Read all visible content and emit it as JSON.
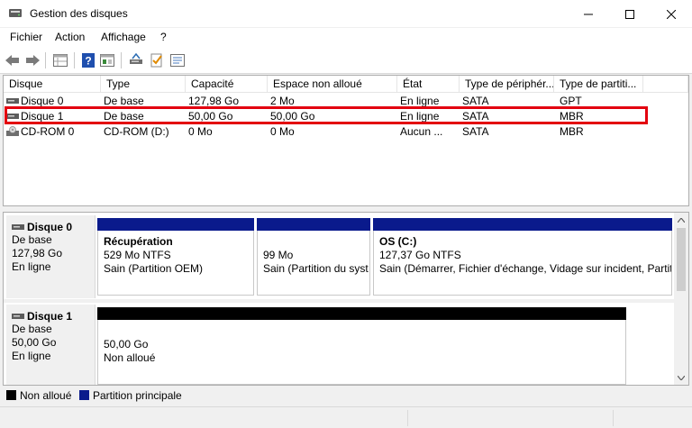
{
  "window": {
    "title": "Gestion des disques"
  },
  "menu": [
    "Fichier",
    "Action",
    "Affichage",
    "?"
  ],
  "toolbar": {
    "icons": [
      "back-arrow-icon",
      "forward-arrow-icon",
      "properties-grid-icon",
      "help-icon",
      "console-tree-icon",
      "disk-rescan-icon",
      "check-icon",
      "settings-list-icon"
    ]
  },
  "volume_list": {
    "columns": [
      "Disque",
      "Type",
      "Capacité",
      "Espace non alloué",
      "État",
      "Type de périphér...",
      "Type de partiti..."
    ],
    "rows": [
      {
        "disk": "Disque 0",
        "type": "De base",
        "capacity": "127,98 Go",
        "unallocated": "2 Mo",
        "state": "En ligne",
        "device_type": "SATA",
        "partition_type": "GPT",
        "icon": "hard-disk-icon"
      },
      {
        "disk": "Disque 1",
        "type": "De base",
        "capacity": "50,00 Go",
        "unallocated": "50,00 Go",
        "state": "En ligne",
        "device_type": "SATA",
        "partition_type": "MBR",
        "icon": "hard-disk-icon"
      },
      {
        "disk": "CD-ROM 0",
        "type": "CD-ROM (D:)",
        "capacity": "0 Mo",
        "unallocated": "0 Mo",
        "state": "Aucun ...",
        "device_type": "SATA",
        "partition_type": "MBR",
        "icon": "cdrom-drive-icon"
      }
    ],
    "highlight_color": "#e3000f"
  },
  "graphical_view": {
    "disks": [
      {
        "name": "Disque 0",
        "lines": [
          "De base",
          "127,98 Go",
          "En ligne"
        ],
        "partitions": [
          {
            "title": "Récupération",
            "lines": [
              "529 Mo NTFS",
              "Sain (Partition OEM)"
            ],
            "bar_color": "#0a1a8c"
          },
          {
            "title": "",
            "lines": [
              "99 Mo",
              "Sain (Partition du syst"
            ],
            "bar_color": "#0a1a8c"
          },
          {
            "title": "OS  (C:)",
            "lines": [
              "127,37 Go NTFS",
              "Sain (Démarrer, Fichier d'échange, Vidage sur incident, Partiti"
            ],
            "bar_color": "#0a1a8c"
          }
        ]
      },
      {
        "name": "Disque 1",
        "lines": [
          "De base",
          "50,00 Go",
          "En ligne"
        ],
        "partitions": [
          {
            "title": "",
            "lines": [
              "50,00 Go",
              "Non alloué"
            ],
            "bar_color": "#000000"
          }
        ]
      }
    ]
  },
  "legend": [
    {
      "label": "Non alloué",
      "color": "#000000"
    },
    {
      "label": "Partition principale",
      "color": "#0a1a8c"
    }
  ]
}
